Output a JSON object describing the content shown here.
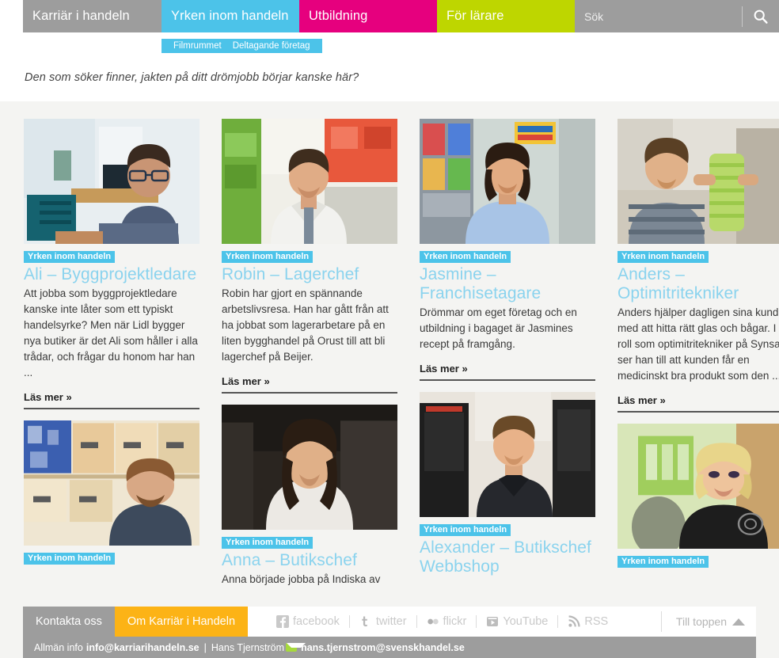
{
  "nav": {
    "items": [
      {
        "label": "Karriär i handeln",
        "color": "#9d9d9d"
      },
      {
        "label": "Yrken inom handeln",
        "color": "#4cc3e9"
      },
      {
        "label": "Utbildning",
        "color": "#e6007e"
      },
      {
        "label": "För lärare",
        "color": "#bed600"
      }
    ],
    "search": {
      "placeholder": "Sök",
      "value": "",
      "icon": "search-icon"
    }
  },
  "subnav": {
    "items": [
      {
        "label": "Filmrummet"
      },
      {
        "label": "Deltagande företag"
      }
    ]
  },
  "tagline": "Den som söker finner, jakten på ditt drömjobb börjar kanske här?",
  "cards": {
    "ali": {
      "tag": "Yrken inom handeln",
      "title": "Ali – Byggprojektledare",
      "text": "Att jobba som byggprojektledare kanske inte låter som ett typiskt handelsyrke? Men när Lidl bygger nya butiker är det Ali som håller i alla trådar, och frågar du honom har han ...",
      "readmore": "Läs mer »"
    },
    "robin": {
      "tag": "Yrken inom handeln",
      "title": "Robin – Lagerchef",
      "text": "Robin har gjort en spännande arbetslivsresa. Han har gått från att ha jobbat som lagerarbetare på en liten bygghandel på Orust till att bli lagerchef på Beijer.",
      "readmore": "Läs mer »"
    },
    "jasmine": {
      "tag": "Yrken inom handeln",
      "title": "Jasmine – Franchisetagare",
      "text": "Drömmar om eget företag och en utbildning i bagaget är Jasmines recept på framgång.",
      "readmore": "Läs mer »"
    },
    "anders": {
      "tag": "Yrken inom handeln",
      "title": "Anders – Optimitritekniker",
      "text": "Anders hjälper dagligen sina kunder med att hitta rätt glas och bågar. I sin roll som optimitritekniker på Synsam ser han till att kunden får en medicinskt bra produkt som den ...",
      "readmore": "Läs mer »"
    },
    "anna": {
      "tag": "Yrken inom handeln",
      "title": "Anna – Butikschef",
      "text": "Anna började jobba på Indiska av"
    },
    "alexander": {
      "tag": "Yrken inom handeln",
      "title": "Alexander – Butikschef Webbshop"
    },
    "lager": {
      "tag": "Yrken inom handeln"
    },
    "bodyshop": {
      "tag": "Yrken inom handeln"
    }
  },
  "footer": {
    "contact_label": "Kontakta oss",
    "about_label": "Om Karriär i Handeln",
    "social": [
      {
        "label": "facebook",
        "icon": "facebook-icon"
      },
      {
        "label": "twitter",
        "icon": "twitter-icon"
      },
      {
        "label": "flickr",
        "icon": "flickr-icon"
      },
      {
        "label": "YouTube",
        "icon": "youtube-icon"
      },
      {
        "label": "RSS",
        "icon": "rss-icon"
      }
    ],
    "to_top": "Till toppen",
    "info": {
      "prefix": "Allmän info",
      "email_general": "info@karriarihandeln.se",
      "separator": "|",
      "person": "Hans Tjernström",
      "email_person": "hans.tjernstrom@svenskhandel.se"
    }
  }
}
